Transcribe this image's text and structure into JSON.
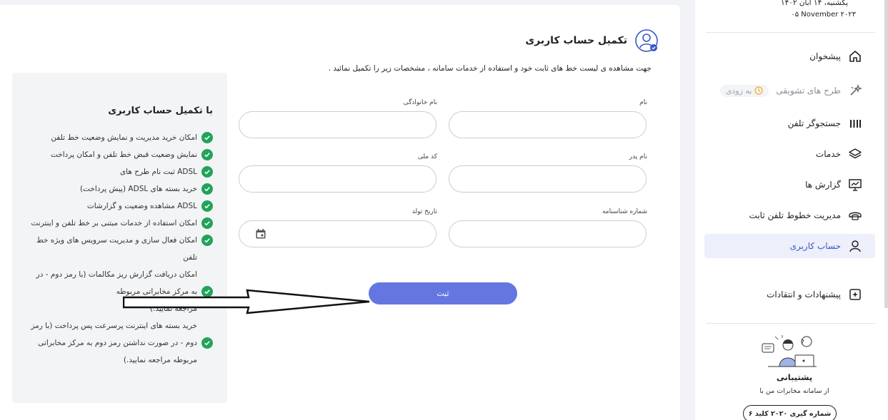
{
  "header": {
    "title": "تکمیل حساب کاربری",
    "subtitle": "جهت مشاهده ی لیست خط های ثابت خود و استفاده از خدمات سامانه ، مشخصات زیر را تکمیل نمائید ."
  },
  "info": {
    "title": "با تکمیل حساب کاربری",
    "items": [
      {
        "text": "امکان خرید مدیریت و نمایش وضعیت خط تلفن",
        "check": true
      },
      {
        "text": "نمایش وضعیت قبض خط تلفن و امکان پرداخت",
        "check": true
      },
      {
        "text": "ADSL ثبت نام طرح های",
        "check": true
      },
      {
        "text": "خرید بسته های ADSL (پیش پرداخت)",
        "check": true
      },
      {
        "text": "ADSL مشاهده وضعیت و گزارشات",
        "check": true
      },
      {
        "text": "امکان استفاده از خدمات مبتنی بر خط تلفن و اینترنت",
        "check": true
      },
      {
        "text": "امکان فعال سازی و مدیریت سرویس های ویژه خط",
        "check": true
      },
      {
        "text": "تلفن",
        "check": false
      },
      {
        "text": "امکان دریافت گزارش ریز مکالمات (با رمز دوم - در",
        "check": false
      },
      {
        "text": "به مرکز مخابراتی مربوطه",
        "check": true
      },
      {
        "text": "مراجعه نمایید.)",
        "check": false
      },
      {
        "text": "خرید بسته های اینترنت پرسرعت پس پرداخت (با رمز",
        "check": false
      },
      {
        "text": "دوم - در صورت نداشتن رمز دوم به مرکز مخابراتی",
        "check": true
      },
      {
        "text": "مربوطه مراجعه نمایید.)",
        "check": false
      }
    ]
  },
  "form": {
    "first_name_label": "نام",
    "last_name_label": "نام خانوادگی",
    "father_name_label": "نام پدر",
    "national_code_label": "کد ملی",
    "id_number_label": "شماره شناسنامه",
    "birth_date_label": "تاریخ تولد",
    "submit_label": "ثبت"
  },
  "sidebar": {
    "date_fa": "یکشنبه، ۱۴ آبان ۱۴۰۲",
    "date_en": "۰۵ November ۲۰۲۳",
    "items": [
      {
        "label": "پیشخوان",
        "icon": "home-icon"
      },
      {
        "label": "طرح های تشویقی",
        "icon": "sparkle-icon",
        "badge": "به زودی"
      },
      {
        "label": "جستجوگر تلفن",
        "icon": "bars-icon"
      },
      {
        "label": "خدمات",
        "icon": "layers-icon"
      },
      {
        "label": "گزارش ها",
        "icon": "presentation-icon"
      },
      {
        "label": "مدیریت خطوط تلفن ثابت",
        "icon": "phone-icon"
      },
      {
        "label": "حساب کاربری",
        "icon": "user-icon"
      },
      {
        "label": "پیشنهادات و انتقادات",
        "icon": "feedback-icon"
      }
    ],
    "support_title": "پشتیبانی",
    "support_subtitle": "از سامانه مخابرات من با",
    "support_badge": "شماره گیری ۲۰۲۰ کلید ۶"
  },
  "colors": {
    "primary": "#6477e0",
    "check": "#22a35a",
    "active_bg": "#edf0fb",
    "active_text": "#3a55c9"
  }
}
